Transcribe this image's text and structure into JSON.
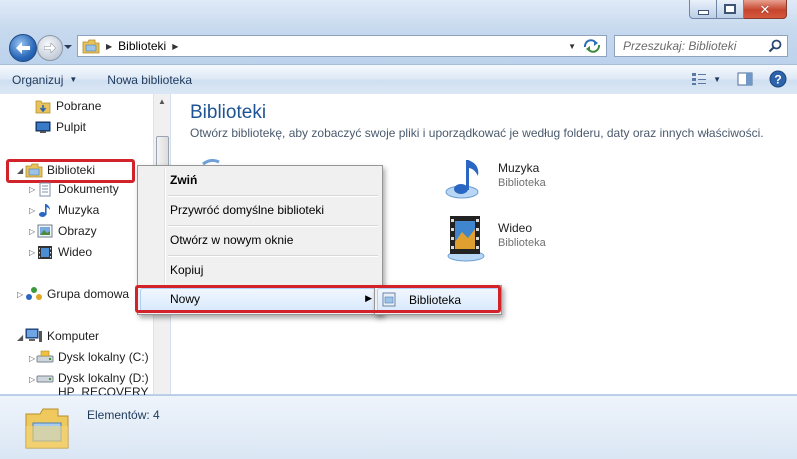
{
  "window": {
    "caption": {
      "minimize_icon": "minimize-icon",
      "maximize_icon": "maximize-icon",
      "close_icon": "close-icon"
    }
  },
  "nav": {
    "back_icon": "back-arrow-icon",
    "forward_icon": "forward-arrow-icon",
    "address": {
      "crumbs": [
        "Biblioteki"
      ]
    },
    "search": {
      "placeholder": "Przeszukaj: Biblioteki"
    }
  },
  "toolbar": {
    "organize_label": "Organizuj",
    "new_library_label": "Nowa biblioteka"
  },
  "sidebar": {
    "items": [
      {
        "label": "Pobrane",
        "icon": "downloads-folder-icon"
      },
      {
        "label": "Pulpit",
        "icon": "desktop-icon"
      },
      {
        "label": "Biblioteki",
        "icon": "libraries-icon"
      },
      {
        "label": "Dokumenty",
        "icon": "documents-icon"
      },
      {
        "label": "Muzyka",
        "icon": "music-icon"
      },
      {
        "label": "Obrazy",
        "icon": "pictures-icon"
      },
      {
        "label": "Wideo",
        "icon": "video-icon"
      },
      {
        "label": "Grupa domowa",
        "icon": "homegroup-icon"
      },
      {
        "label": "Komputer",
        "icon": "computer-icon"
      },
      {
        "label": "Dysk lokalny (C:)",
        "icon": "drive-c-icon"
      },
      {
        "label": "Dysk lokalny (D:)",
        "icon": "drive-d-icon"
      },
      {
        "label": "HP_RECOVERY (E:)",
        "icon": "drive-e-icon"
      }
    ]
  },
  "main": {
    "title": "Biblioteki",
    "subtitle": "Otwórz bibliotekę, aby zobaczyć swoje pliki i uporządkować je według folderu, daty oraz innych właściwości.",
    "libraries": [
      {
        "name": "Muzyka",
        "type": "Biblioteka"
      },
      {
        "name": "Wideo",
        "type": "Biblioteka"
      }
    ]
  },
  "context_menu": {
    "items": [
      {
        "label": "Zwiń"
      },
      {
        "label": "Przywróć domyślne biblioteki"
      },
      {
        "label": "Otwórz w nowym oknie"
      },
      {
        "label": "Kopiuj"
      },
      {
        "label": "Nowy"
      }
    ],
    "submenu": {
      "label": "Biblioteka"
    }
  },
  "details": {
    "status": "Elementów: 4"
  },
  "colors": {
    "highlight": "#d2232a",
    "title_blue": "#1e5494"
  }
}
